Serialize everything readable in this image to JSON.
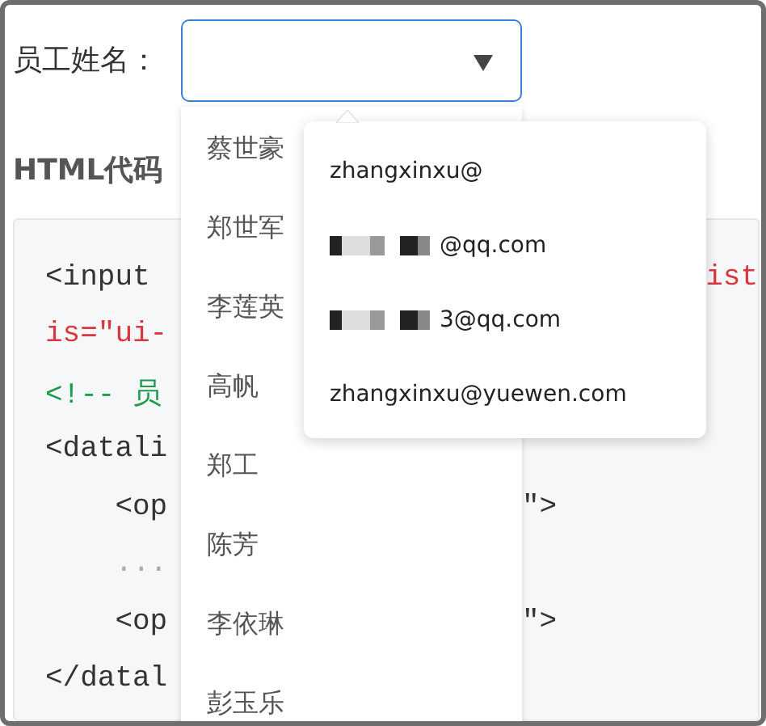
{
  "form": {
    "label": "员工姓名："
  },
  "section_title": "HTML代码",
  "code_lines": [
    {
      "text": "<input",
      "kind": "markup",
      "tail": {
        "text": "ist",
        "kind": "attribute"
      }
    },
    {
      "text": "is=\"ui-",
      "kind": "attribute"
    },
    {
      "text": "<!-- 员",
      "kind": "comment"
    },
    {
      "text": "<datali",
      "kind": "markup"
    },
    {
      "text": "    <op",
      "kind": "markup",
      "tail": {
        "text": "\">",
        "kind": "markup"
      }
    },
    {
      "text": "    ...",
      "kind": "ellipsis"
    },
    {
      "text": "    <op",
      "kind": "markup",
      "tail": {
        "text": "\">",
        "kind": "markup"
      }
    },
    {
      "text": "</datal",
      "kind": "markup"
    }
  ],
  "name_options": [
    "蔡世豪",
    "郑世军",
    "李莲英",
    "高帆",
    "郑工",
    "陈芳",
    "李依琳",
    "彭玉乐"
  ],
  "email_suggestions": [
    {
      "text": "zhangxinxu@",
      "redacted": false
    },
    {
      "text": "@qq.com",
      "redacted": true
    },
    {
      "text": "3@qq.com",
      "redacted": true
    },
    {
      "text": "zhangxinxu@yuewen.com",
      "redacted": false
    }
  ]
}
